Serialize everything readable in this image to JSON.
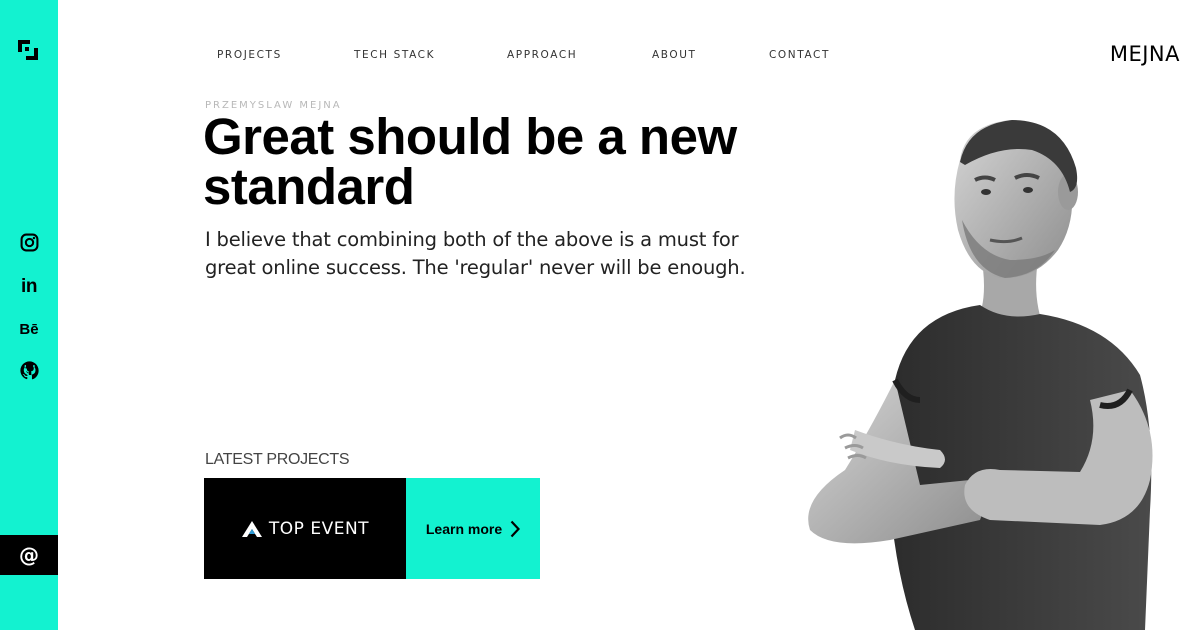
{
  "sidebar": {
    "logo_icon": "bracket-square-logo-icon",
    "social": [
      {
        "name": "instagram",
        "icon": "instagram-icon"
      },
      {
        "name": "linkedin",
        "icon": "linkedin-icon",
        "glyph": "in"
      },
      {
        "name": "behance",
        "icon": "behance-icon",
        "glyph": "Bē"
      },
      {
        "name": "github",
        "icon": "github-icon"
      }
    ],
    "email_glyph": "@",
    "accent_color": "#13f2d0"
  },
  "nav": {
    "items": [
      "PROJECTS",
      "TECH STACK",
      "APPROACH",
      "ABOUT",
      "CONTACT"
    ]
  },
  "brand": "MEJNA",
  "hero": {
    "eyebrow": "PRZEMYSLAW MEJNA",
    "headline_line1": "Great should be a new",
    "headline_line2": "standard",
    "subtext_line1": "I believe that combining both of the above is a must for",
    "subtext_line2": "great online success. The 'regular' never will be enough."
  },
  "latest": {
    "label": "LATEST PROJECTS",
    "project_name": "TOP EVENT",
    "cta": "Learn more"
  }
}
